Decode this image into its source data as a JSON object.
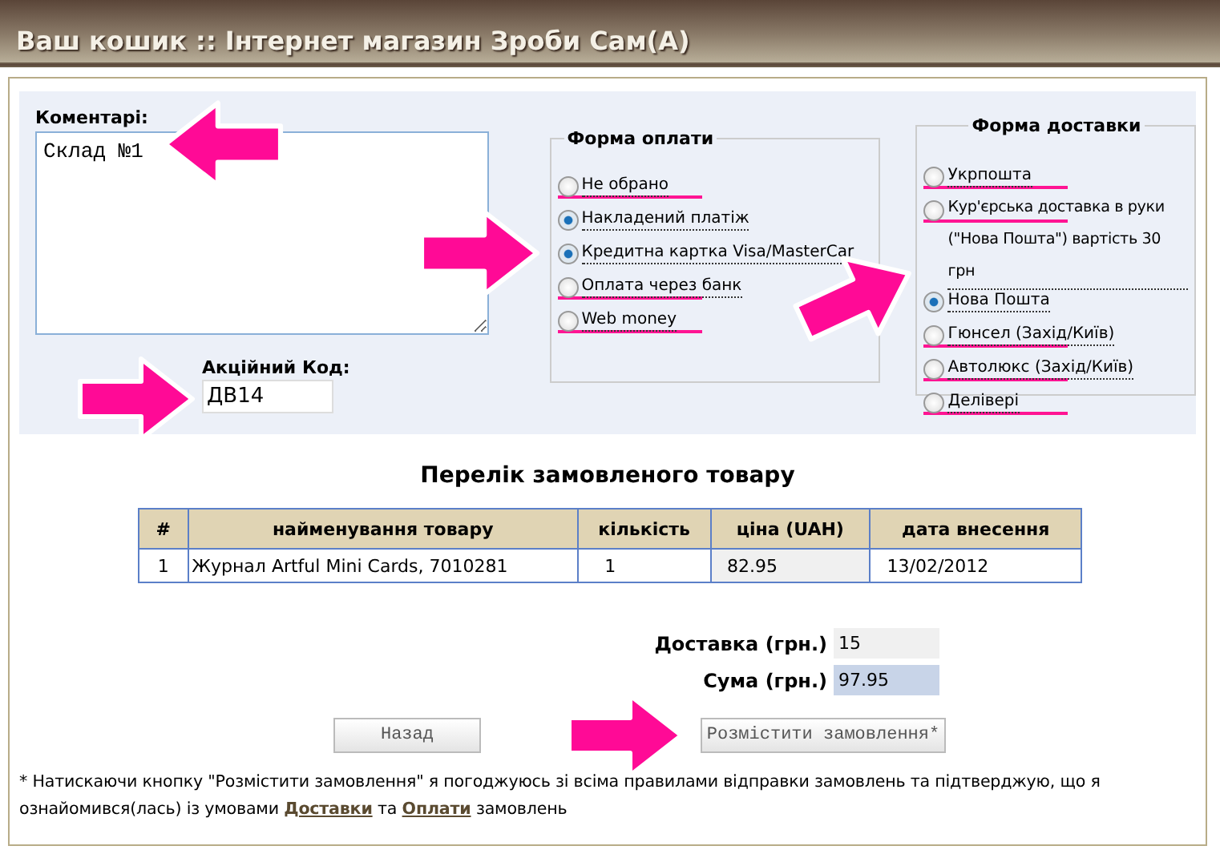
{
  "window": {
    "title": "Ваш кошик :: Інтернет магазин Зроби Сам(А)"
  },
  "comments": {
    "label": "Коментарі:",
    "value": "Склад №1"
  },
  "promo": {
    "label": "Акційний Код:",
    "value": "ДВ14"
  },
  "payment": {
    "legend": "Форма оплати",
    "options": [
      {
        "label": "Не обрано",
        "selected": false,
        "struck": true
      },
      {
        "label": "Накладений платіж",
        "selected": true,
        "struck": false
      },
      {
        "label": "Кредитна картка Visa/MasterCar",
        "selected": true,
        "struck": false
      },
      {
        "label": "Оплата через банк",
        "selected": false,
        "struck": true
      },
      {
        "label": "Web money",
        "selected": false,
        "struck": true
      }
    ]
  },
  "delivery": {
    "legend": "Форма доставки",
    "options": [
      {
        "label": "Укрпошта",
        "selected": false,
        "struck": true
      },
      {
        "label": "Кур'єрська доставка в руки (\"Нова Пошта\") вартість 30 грн",
        "selected": false,
        "struck": true
      },
      {
        "label": "Нова Пошта",
        "selected": true,
        "struck": false
      },
      {
        "label": "Гюнсел (Захід/Київ)",
        "selected": false,
        "struck": true
      },
      {
        "label": "Автолюкс (Захід/Київ)",
        "selected": false,
        "struck": true
      },
      {
        "label": "Делівері",
        "selected": false,
        "struck": true
      }
    ]
  },
  "order": {
    "title": "Перелік замовленого товару",
    "columns": [
      "#",
      "найменування товару",
      "кількість",
      "ціна (UAH)",
      "дата внесення"
    ],
    "rows": [
      [
        "1",
        "Журнал Artful Mini Cards, 7010281",
        "1",
        "82.95",
        "13/02/2012"
      ]
    ]
  },
  "totals": [
    {
      "label": "Доставка (грн.)",
      "value": "15",
      "kind": "plain"
    },
    {
      "label": "Сума (грн.)",
      "value": "97.95",
      "kind": "highlight"
    }
  ],
  "buttons": [
    {
      "label": "Назад"
    },
    {
      "label": "Розмістити замовлення*"
    }
  ],
  "note": {
    "before": "* Натискаючи кнопку \"Розмістити замовлення\" я погоджуюсь зі всіма правилами відправки замовлень та підтверджую, що я ознайомився(лась) із умовами",
    "link1": "Доставки",
    "middle": "та",
    "link2": "Оплати",
    "after": "замовлень"
  }
}
